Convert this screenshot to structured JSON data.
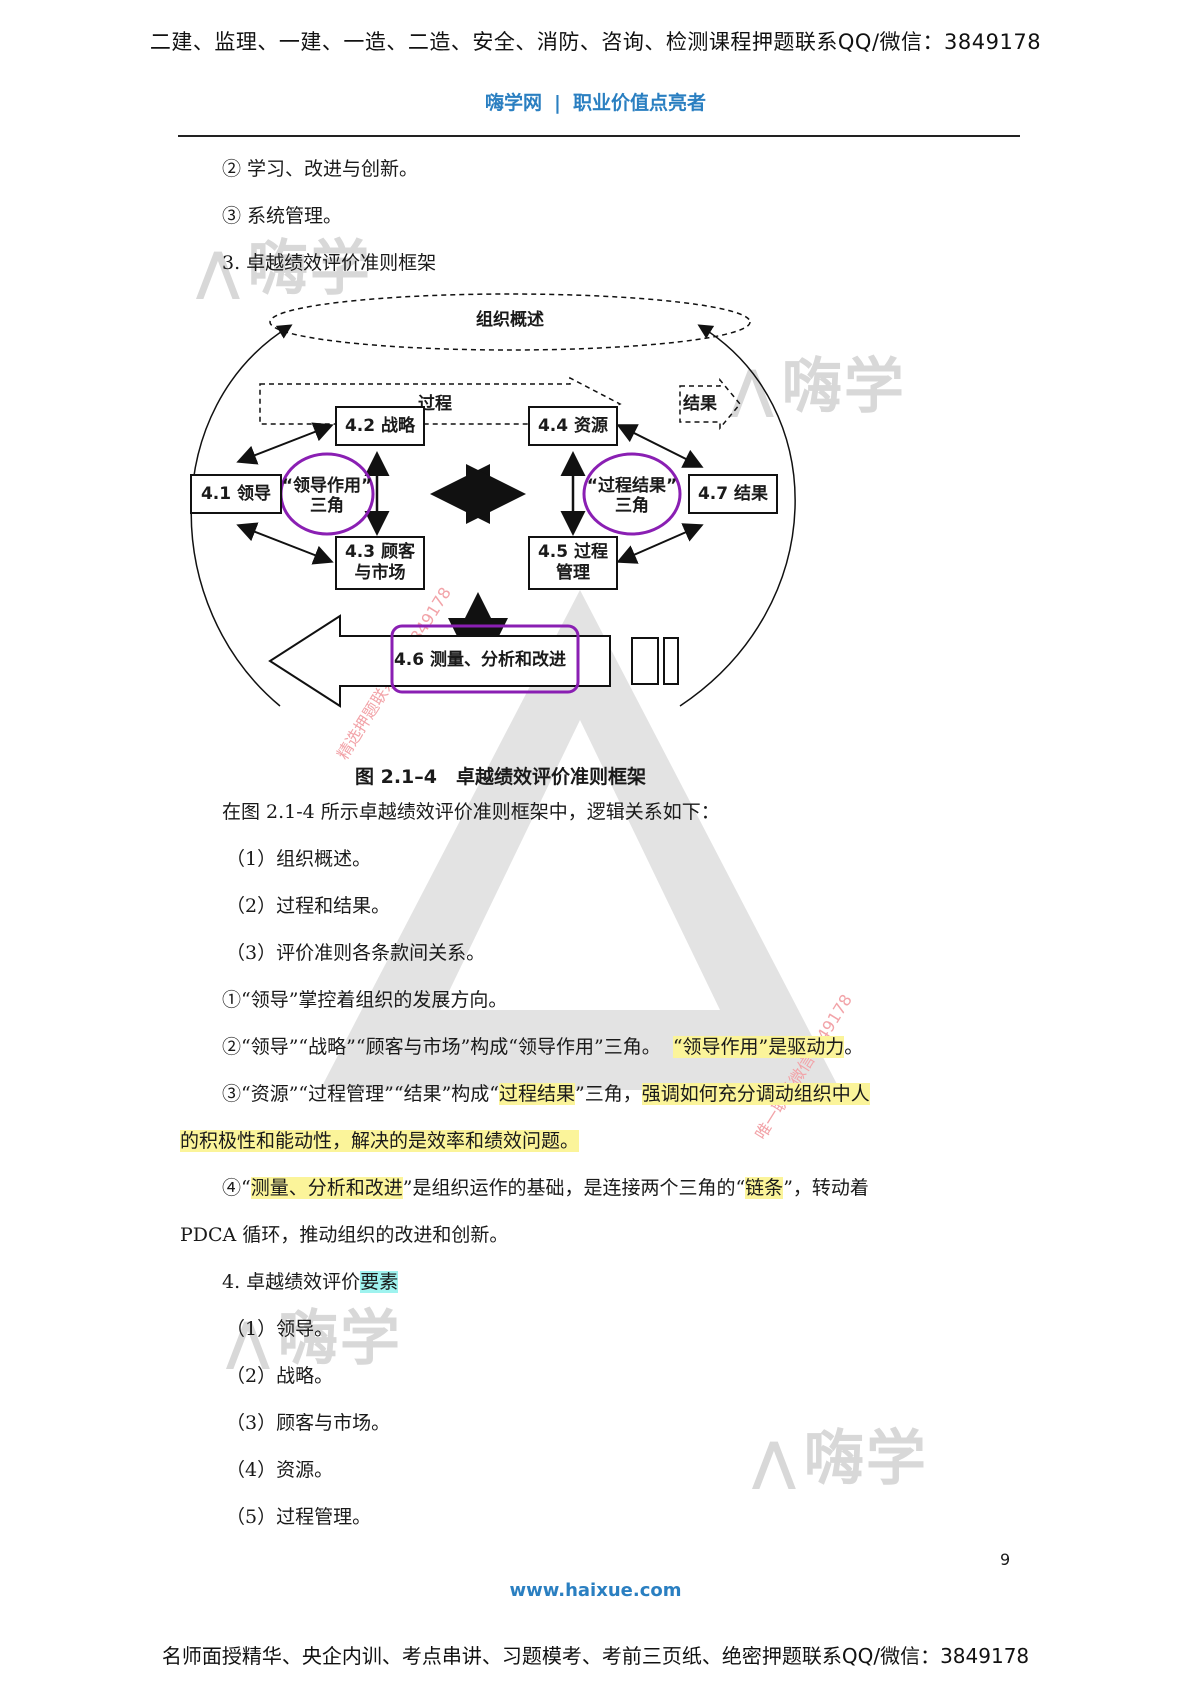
{
  "header": {
    "ad_text": "二建、监理、一建、一造、二造、安全、消防、咨询、检测课程押题联系QQ/微信：3849178",
    "brand_name": "嗨学网",
    "brand_sep": "|",
    "brand_slogan": "职业价值点亮者"
  },
  "watermark": {
    "logo_text": "嗨学",
    "diag_text_1": "精选押题联系微信3849178",
    "diag_text_2": "唯一联系微信3849178"
  },
  "body": {
    "line_1": "② 学习、改进与创新。",
    "line_2": "③ 系统管理。",
    "line_3": "3. 卓越绩效评价准则框架",
    "intro": "在图 2.1-4 所示卓越绩效评价准则框架中，逻辑关系如下：",
    "item_1": "（1）组织概述。",
    "item_2": "（2）过程和结果。",
    "item_3": "（3）评价准则各条款间关系。",
    "rel_1": "①“领导”掌控着组织的发展方向。",
    "rel_2_a": "②“领导”“战略”“顾客与市场”构成“领导作用”三角。",
    "rel_2_b": "“领导作用”是驱动力",
    "rel_2_c": "。",
    "rel_3_a": "③“资源”“过程管理”“结果”构成“",
    "rel_3_b": "过程结果",
    "rel_3_c": "”三角，",
    "rel_3_d": "强调如何充分调动组织中人",
    "rel_3_e": "的积极性和能动性，解决的是效率和绩效问题。",
    "rel_4_a": "④“",
    "rel_4_b": "测量、分析和改进",
    "rel_4_c": "”是组织运作的基础，是连接两个三角的“",
    "rel_4_d": "链条",
    "rel_4_e": "”，转动着",
    "rel_4_f": "PDCA 循环，推动组织的改进和创新。",
    "sec_4_a": "4. 卓越绩效评价",
    "sec_4_b": "要素",
    "el_1": "（1）领导。",
    "el_2": "（2）战略。",
    "el_3": "（3）顾客与市场。",
    "el_4": "（4）资源。",
    "el_5": "（5）过程管理。"
  },
  "diagram": {
    "org_overview": "组织概述",
    "process": "过程",
    "result_arrow": "结果",
    "b41": "4.1 领导",
    "b42": "4.2 战略",
    "b43_1": "4.3 顾客",
    "b43_2": "与市场",
    "b44": "4.4 资源",
    "b45_1": "4.5 过程",
    "b45_2": "管理",
    "b47": "4.7 结果",
    "b46": "4.6 测量、分析和改进",
    "tri_left_1": "“领导作用”",
    "tri_left_2": "三角",
    "tri_right_1": "“过程结果”",
    "tri_right_2": "三角",
    "caption": "图 2.1–4　卓越绩效评价准则框架",
    "annotation_color": "#8a1fb3"
  },
  "footer": {
    "page_number": "9",
    "site": "www.haixue.com",
    "ad_text": "名师面授精华、央企内训、考点串讲、习题模考、考前三页纸、绝密押题联系QQ/微信：3849178"
  }
}
